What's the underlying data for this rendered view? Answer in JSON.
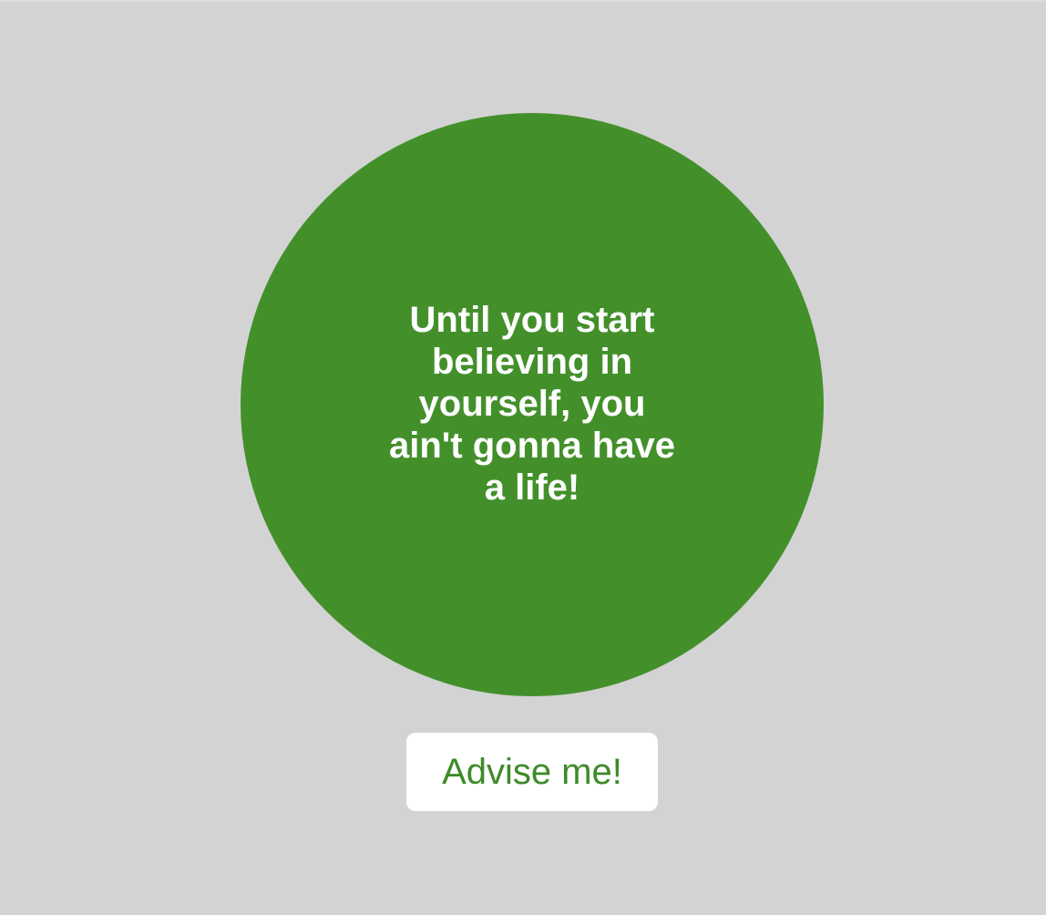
{
  "advice": {
    "quote": "Until you start believing in yourself, you ain't gonna have a life!"
  },
  "actions": {
    "advise_label": "Advise me!"
  },
  "colors": {
    "background": "#d3d3d3",
    "circle": "#43902b",
    "quote_text": "#ffffff",
    "button_background": "#ffffff",
    "button_text": "#3d8b28"
  }
}
